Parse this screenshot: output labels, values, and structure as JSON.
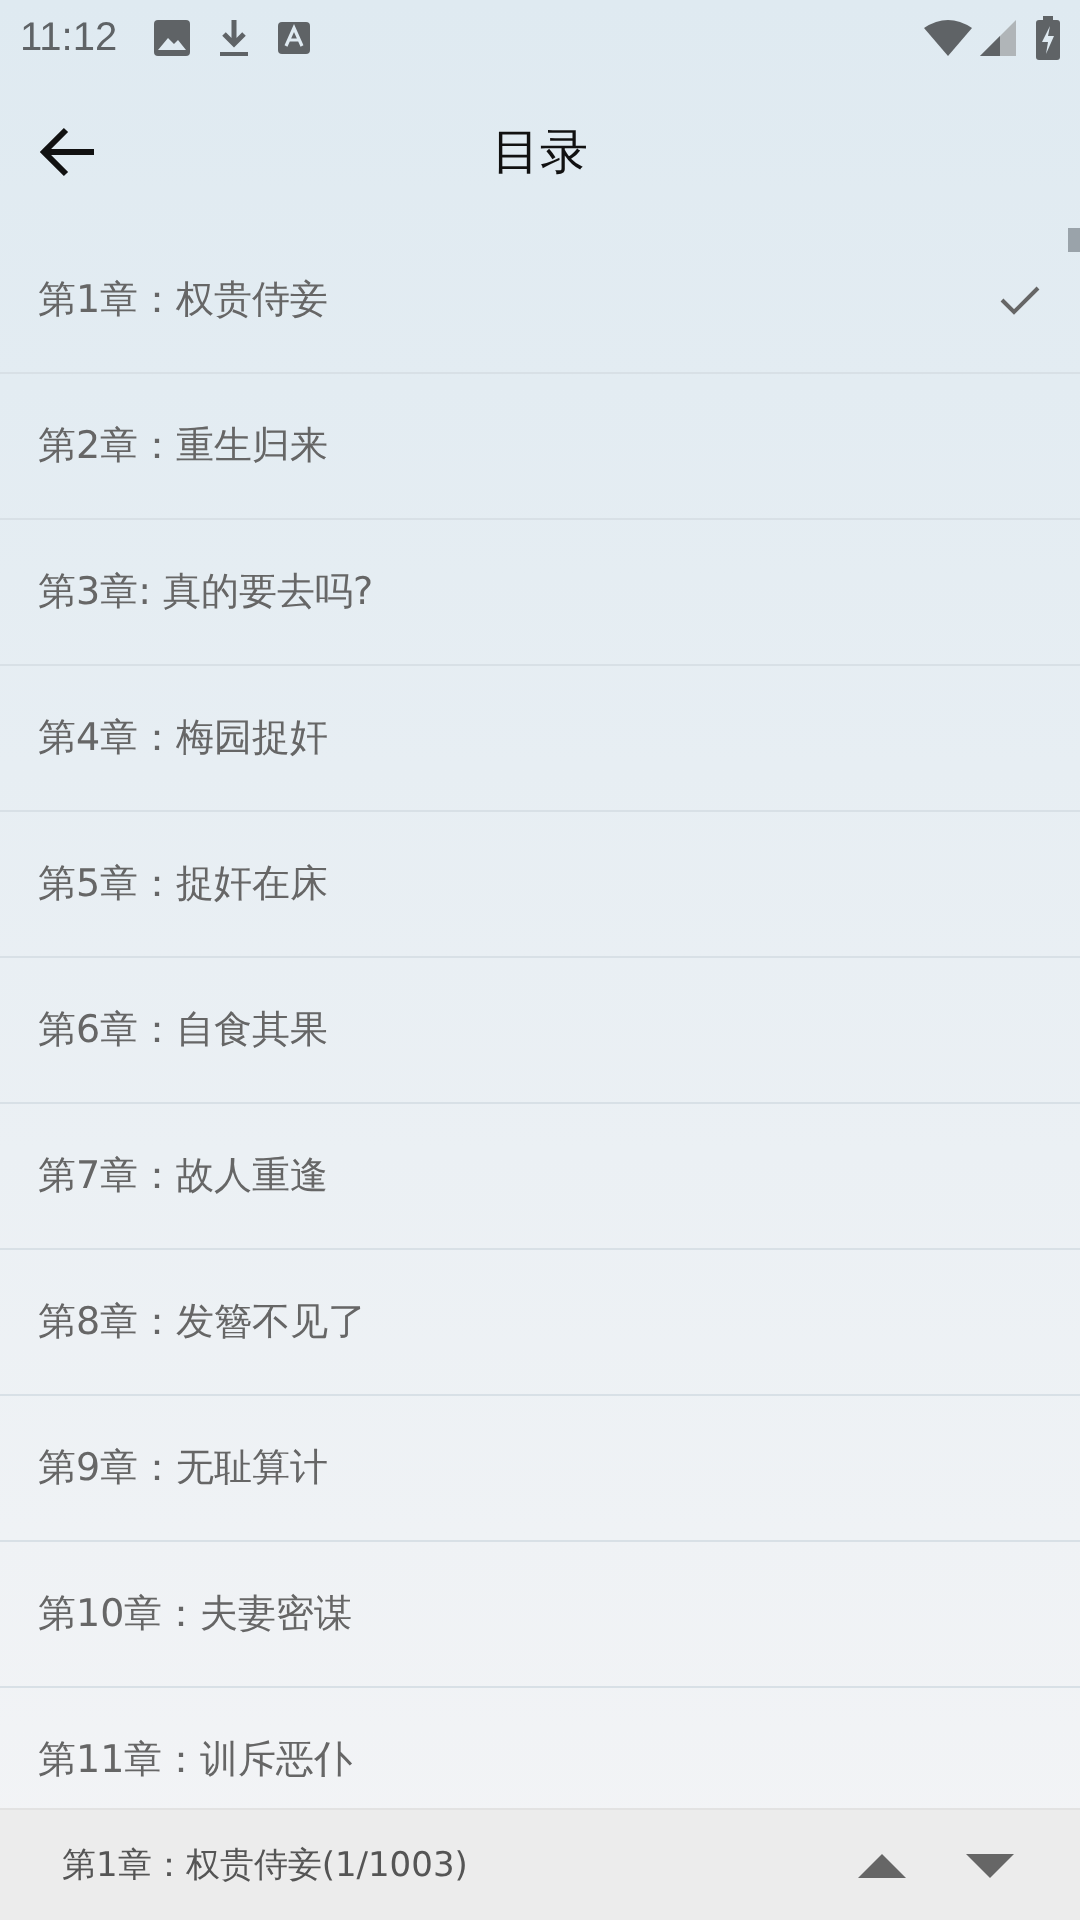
{
  "status_bar": {
    "time": "11:12"
  },
  "header": {
    "title": "目录"
  },
  "chapters": [
    {
      "title": "第1章：权贵侍妾",
      "selected": true
    },
    {
      "title": "第2章：重生归来",
      "selected": false
    },
    {
      "title": "第3章: 真的要去吗?",
      "selected": false
    },
    {
      "title": "第4章：梅园捉奸",
      "selected": false
    },
    {
      "title": "第5章：捉奸在床",
      "selected": false
    },
    {
      "title": "第6章：自食其果",
      "selected": false
    },
    {
      "title": "第7章：故人重逢",
      "selected": false
    },
    {
      "title": "第8章：发簪不见了",
      "selected": false
    },
    {
      "title": "第9章：无耻算计",
      "selected": false
    },
    {
      "title": "第10章：夫妻密谋",
      "selected": false
    },
    {
      "title": "第11章：训斥恶仆",
      "selected": false
    }
  ],
  "footer": {
    "current": "第1章：权贵侍妾(1/1003)"
  }
}
